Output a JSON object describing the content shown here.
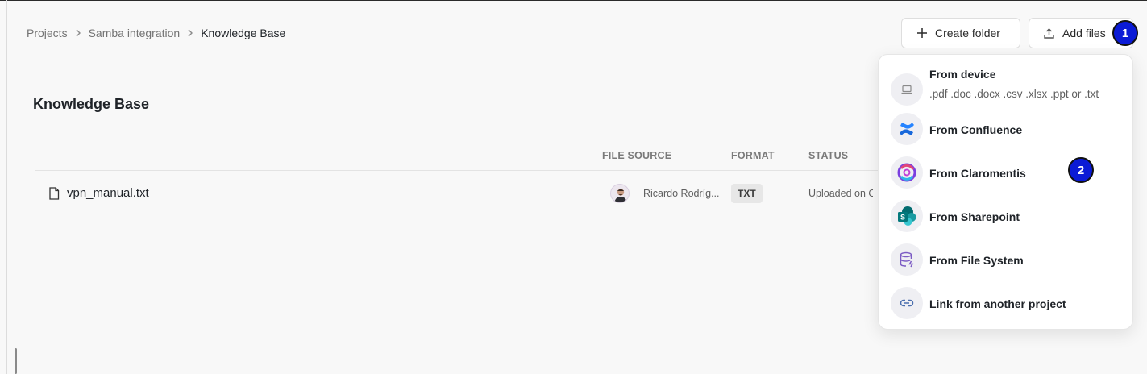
{
  "breadcrumb": {
    "items": [
      "Projects",
      "Samba integration",
      "Knowledge Base"
    ]
  },
  "toolbar": {
    "create_folder_label": "Create folder",
    "add_files_label": "Add files"
  },
  "markers": [
    "1",
    "2"
  ],
  "page": {
    "title": "Knowledge Base"
  },
  "table": {
    "columns": [
      "FILE SOURCE",
      "FORMAT",
      "STATUS"
    ],
    "rows": [
      {
        "name": "vpn_manual.txt",
        "owner": "Ricardo Rodríg...",
        "format": "TXT",
        "status": "Uploaded on Oc"
      }
    ]
  },
  "menu": {
    "items": [
      {
        "label": "From device",
        "sub": ".pdf .doc .docx .csv .xlsx .ppt or .txt",
        "icon": "laptop-icon"
      },
      {
        "label": "From Confluence",
        "icon": "confluence-icon"
      },
      {
        "label": "From Claromentis",
        "icon": "claromentis-icon"
      },
      {
        "label": "From Sharepoint",
        "icon": "sharepoint-icon"
      },
      {
        "label": "From File System",
        "icon": "database-icon"
      },
      {
        "label": "Link from another project",
        "icon": "link-icon"
      }
    ]
  },
  "colors": {
    "marker": "#0b1bd6",
    "confluence": "#1868db",
    "sharepoint": "#0f7b6c",
    "filesystem": "#7c5cc4"
  }
}
